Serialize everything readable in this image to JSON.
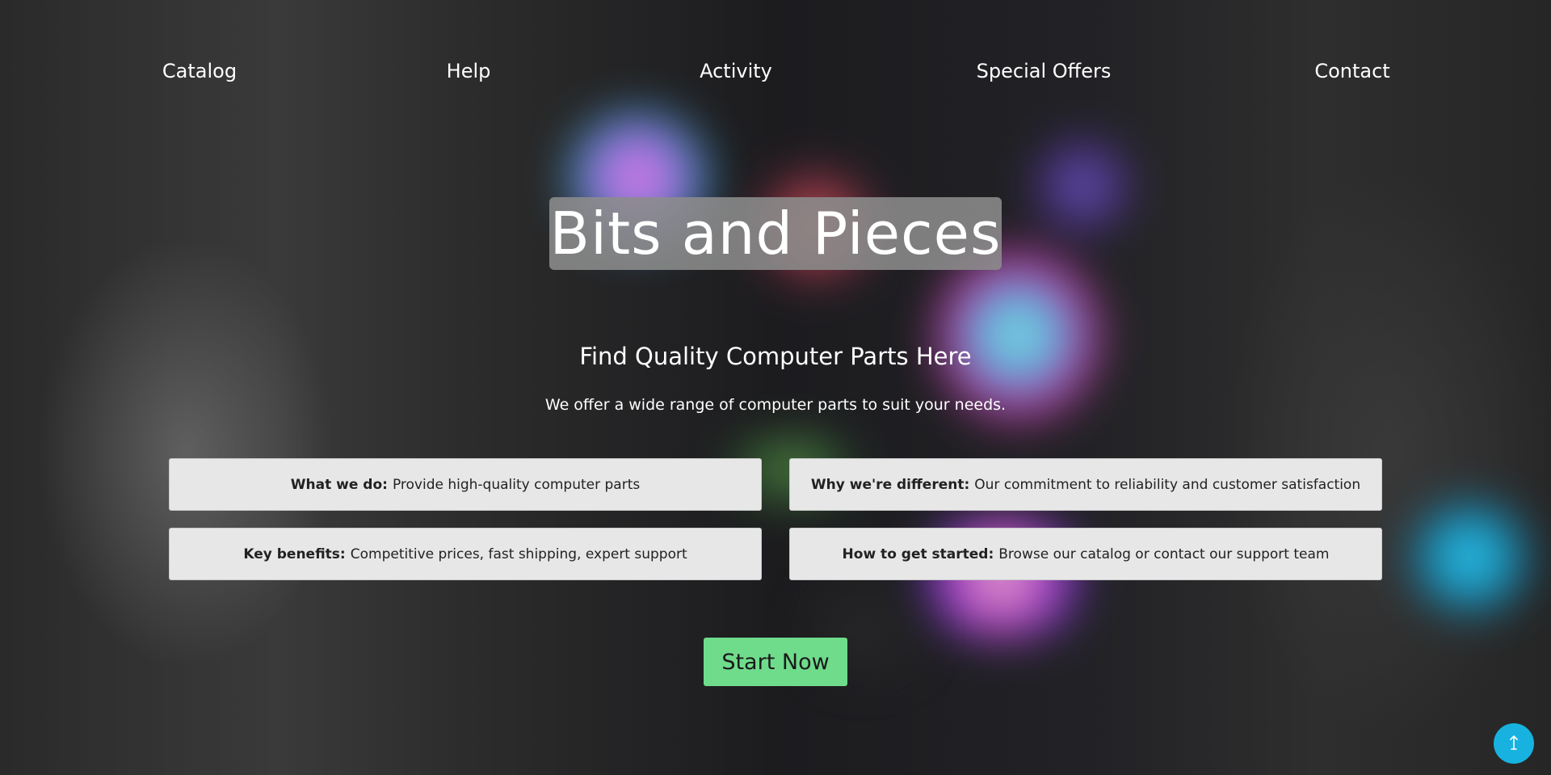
{
  "nav": {
    "items": [
      {
        "label": "Catalog"
      },
      {
        "label": "Help"
      },
      {
        "label": "Activity"
      },
      {
        "label": "Special Offers"
      },
      {
        "label": "Contact"
      }
    ]
  },
  "hero": {
    "title": "Bits and Pieces",
    "subtitle": "Find Quality Computer Parts Here",
    "description": "We offer a wide range of computer parts to suit your needs."
  },
  "features": [
    {
      "heading": "What we do:",
      "text": "Provide high-quality computer parts"
    },
    {
      "heading": "Why we're different:",
      "text": "Our commitment to reliability and customer satisfaction"
    },
    {
      "heading": "Key benefits:",
      "text": "Competitive prices, fast shipping, expert support"
    },
    {
      "heading": "How to get started:",
      "text": "Browse our catalog or contact our support team"
    }
  ],
  "cta": {
    "label": "Start Now"
  },
  "back_to_top": {
    "icon": "arrow-up-icon"
  },
  "colors": {
    "cta_background": "#6fdc8c",
    "back_to_top_background": "#17b2e0",
    "card_background": "#e7e7e7",
    "title_background": "#8c8c8c"
  }
}
